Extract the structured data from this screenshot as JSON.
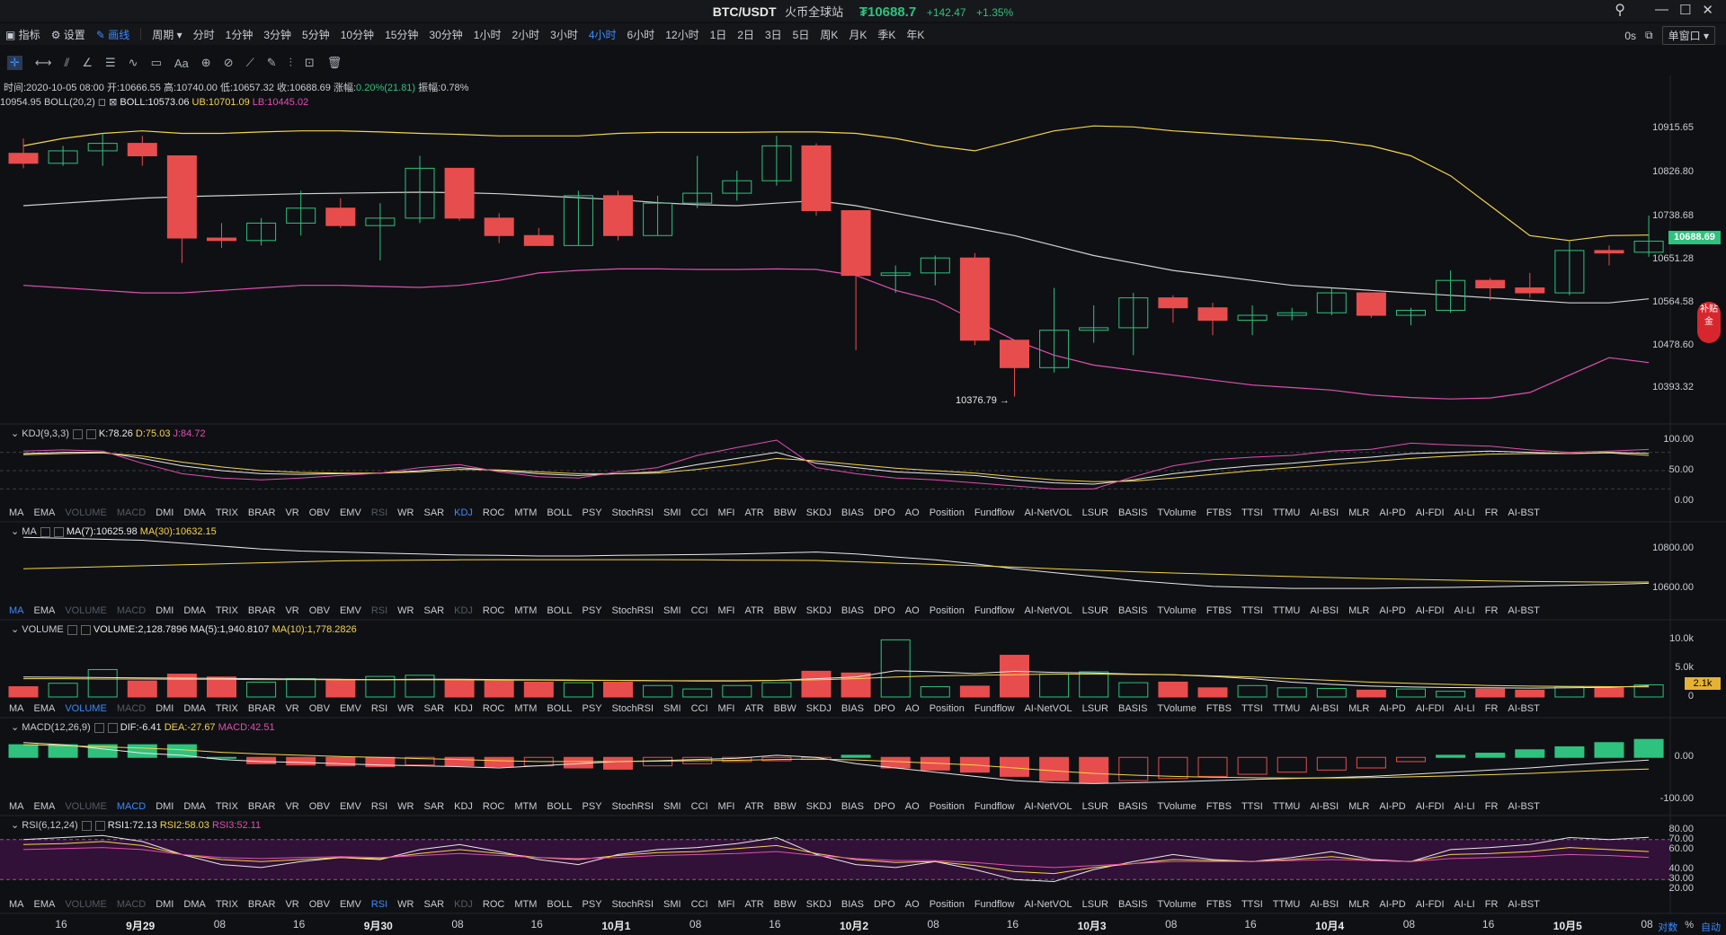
{
  "header": {
    "pair": "BTC/USDT",
    "exchange": "火币全球站",
    "last_price": "₮10688.7",
    "change_abs": "+142.47",
    "change_pct": "+1.35%"
  },
  "period_bar": {
    "items": [
      "指标",
      "设置",
      "画线"
    ],
    "period_label": "周期",
    "periods": [
      "分时",
      "1分钟",
      "3分钟",
      "5分钟",
      "10分钟",
      "15分钟",
      "30分钟",
      "1小时",
      "2小时",
      "3小时",
      "4小时",
      "6小时",
      "12小时",
      "1日",
      "2日",
      "3日",
      "5日",
      "周K",
      "月K",
      "季K",
      "年K"
    ],
    "active_period": "4小时",
    "countdown": "0s",
    "window_select": "单窗口"
  },
  "toolbar_icons": [
    "crosshair-icon",
    "horizontal-line-icon",
    "trend-lines-icon",
    "angle-icon",
    "parallel-lines-icon",
    "wave-icon",
    "rectangle-icon",
    "text-icon",
    "magnet-icon",
    "link-icon",
    "ruler-icon",
    "pencil-icon",
    "bars-icon",
    "lock-icon",
    "trash-icon"
  ],
  "toolbar_text": "Aa",
  "info_line": {
    "time": "时间:2020-10-05 08:00",
    "open": "开:10666.55",
    "high": "高:10740.00",
    "low": "低:10657.32",
    "close": "收:10688.69",
    "change_label": "涨幅:",
    "change_val": "0.20%(21.81)",
    "amp": "振幅:0.78%"
  },
  "boll_line": {
    "prefix": "10954.95",
    "label": "BOLL(20,2)",
    "mid": "BOLL:10573.06",
    "ub": "UB:10701.09",
    "lb": "LB:10445.02"
  },
  "price_axis": [
    "10915.65",
    "10826.80",
    "10738.68",
    "10651.28",
    "10564.58",
    "10478.60",
    "10393.32"
  ],
  "price_badge": "10688.69",
  "low_annotation": "10376.79 →",
  "kdj": {
    "label": "KDJ(9,3,3)",
    "k": "K:78.26",
    "d": "D:75.03",
    "j": "J:84.72",
    "axis": [
      "100.00",
      "50.00",
      "0.00"
    ]
  },
  "ma": {
    "label": "MA",
    "ma7": "MA(7):10625.98",
    "ma30": "MA(30):10632.15",
    "axis": [
      "10800.00",
      "10600.00"
    ]
  },
  "volume": {
    "label": "VOLUME",
    "vol": "VOLUME:2,128.7896",
    "ma5": "MA(5):1,940.8107",
    "ma10": "MA(10):1,778.2826",
    "axis": [
      "10.0k",
      "5.0k",
      "0"
    ],
    "badge": "2.1k"
  },
  "macd": {
    "label": "MACD(12,26,9)",
    "dif": "DIF:-6.41",
    "dea": "DEA:-27.67",
    "macd": "MACD:42.51",
    "axis": [
      "0.00",
      "-100.00"
    ]
  },
  "rsi": {
    "label": "RSI(6,12,24)",
    "rsi1": "RSI1:72.13",
    "rsi2": "RSI2:58.03",
    "rsi3": "RSI3:52.11",
    "axis": [
      "80.00",
      "70.00",
      "60.00",
      "40.00",
      "30.00",
      "20.00"
    ]
  },
  "indicator_list": [
    "MA",
    "EMA",
    "VOLUME",
    "MACD",
    "DMI",
    "DMA",
    "TRIX",
    "BRAR",
    "VR",
    "OBV",
    "EMV",
    "RSI",
    "WR",
    "SAR",
    "KDJ",
    "ROC",
    "MTM",
    "BOLL",
    "PSY",
    "StochRSI",
    "SMI",
    "CCI",
    "MFI",
    "ATR",
    "BBW",
    "SKDJ",
    "BIAS",
    "DPO",
    "AO",
    "Position",
    "Fundflow",
    "AI-NetVOL",
    "LSUR",
    "BASIS",
    "TVolume",
    "FTBS",
    "TTSI",
    "TTMU",
    "AI-BSI",
    "MLR",
    "AI-PD",
    "AI-FDI",
    "AI-LI",
    "FR",
    "AI-BST"
  ],
  "x_axis": [
    {
      "t": "16",
      "b": false
    },
    {
      "t": "9月29",
      "b": true
    },
    {
      "t": "08",
      "b": false
    },
    {
      "t": "16",
      "b": false
    },
    {
      "t": "9月30",
      "b": true
    },
    {
      "t": "08",
      "b": false
    },
    {
      "t": "16",
      "b": false
    },
    {
      "t": "10月1",
      "b": true
    },
    {
      "t": "08",
      "b": false
    },
    {
      "t": "16",
      "b": false
    },
    {
      "t": "10月2",
      "b": true
    },
    {
      "t": "08",
      "b": false
    },
    {
      "t": "16",
      "b": false
    },
    {
      "t": "10月3",
      "b": true
    },
    {
      "t": "08",
      "b": false
    },
    {
      "t": "16",
      "b": false
    },
    {
      "t": "10月4",
      "b": true
    },
    {
      "t": "08",
      "b": false
    },
    {
      "t": "16",
      "b": false
    },
    {
      "t": "10月5",
      "b": true
    },
    {
      "t": "08",
      "b": false
    }
  ],
  "bottom_links": [
    "对数",
    "%",
    "自动"
  ],
  "side_badge": "补贴金",
  "colors": {
    "up": "#2ec27e",
    "down": "#e84d4d",
    "ub": "#f5d547",
    "lb": "#e04fb0",
    "mid": "#d0d0d0",
    "accent": "#3b8bff"
  },
  "chart_data": {
    "type": "candlestick",
    "interval": "4小时",
    "ylim": [
      10340,
      10960
    ],
    "candles": [
      {
        "o": 10865,
        "h": 10895,
        "l": 10835,
        "c": 10845
      },
      {
        "o": 10845,
        "h": 10880,
        "l": 10840,
        "c": 10870
      },
      {
        "o": 10870,
        "h": 10905,
        "l": 10840,
        "c": 10885
      },
      {
        "o": 10885,
        "h": 10900,
        "l": 10840,
        "c": 10860
      },
      {
        "o": 10860,
        "h": 10860,
        "l": 10645,
        "c": 10695
      },
      {
        "o": 10695,
        "h": 10725,
        "l": 10675,
        "c": 10690
      },
      {
        "o": 10690,
        "h": 10735,
        "l": 10680,
        "c": 10725
      },
      {
        "o": 10725,
        "h": 10790,
        "l": 10700,
        "c": 10755
      },
      {
        "o": 10755,
        "h": 10775,
        "l": 10715,
        "c": 10720
      },
      {
        "o": 10720,
        "h": 10765,
        "l": 10650,
        "c": 10735
      },
      {
        "o": 10735,
        "h": 10860,
        "l": 10725,
        "c": 10835
      },
      {
        "o": 10835,
        "h": 10835,
        "l": 10730,
        "c": 10735
      },
      {
        "o": 10735,
        "h": 10745,
        "l": 10685,
        "c": 10700
      },
      {
        "o": 10700,
        "h": 10715,
        "l": 10680,
        "c": 10680
      },
      {
        "o": 10680,
        "h": 10790,
        "l": 10680,
        "c": 10780
      },
      {
        "o": 10780,
        "h": 10790,
        "l": 10690,
        "c": 10700
      },
      {
        "o": 10700,
        "h": 10780,
        "l": 10700,
        "c": 10765
      },
      {
        "o": 10765,
        "h": 10860,
        "l": 10755,
        "c": 10785
      },
      {
        "o": 10785,
        "h": 10830,
        "l": 10770,
        "c": 10810
      },
      {
        "o": 10810,
        "h": 10900,
        "l": 10800,
        "c": 10880
      },
      {
        "o": 10880,
        "h": 10885,
        "l": 10740,
        "c": 10750
      },
      {
        "o": 10750,
        "h": 10750,
        "l": 10470,
        "c": 10620
      },
      {
        "o": 10620,
        "h": 10640,
        "l": 10585,
        "c": 10625
      },
      {
        "o": 10625,
        "h": 10660,
        "l": 10600,
        "c": 10655
      },
      {
        "o": 10655,
        "h": 10665,
        "l": 10480,
        "c": 10490
      },
      {
        "o": 10490,
        "h": 10490,
        "l": 10377,
        "c": 10435
      },
      {
        "o": 10435,
        "h": 10595,
        "l": 10425,
        "c": 10510
      },
      {
        "o": 10510,
        "h": 10560,
        "l": 10485,
        "c": 10515
      },
      {
        "o": 10515,
        "h": 10585,
        "l": 10460,
        "c": 10575
      },
      {
        "o": 10575,
        "h": 10580,
        "l": 10525,
        "c": 10555
      },
      {
        "o": 10555,
        "h": 10565,
        "l": 10500,
        "c": 10530
      },
      {
        "o": 10530,
        "h": 10560,
        "l": 10500,
        "c": 10540
      },
      {
        "o": 10540,
        "h": 10555,
        "l": 10530,
        "c": 10545
      },
      {
        "o": 10545,
        "h": 10595,
        "l": 10540,
        "c": 10585
      },
      {
        "o": 10585,
        "h": 10585,
        "l": 10535,
        "c": 10540
      },
      {
        "o": 10540,
        "h": 10555,
        "l": 10520,
        "c": 10550
      },
      {
        "o": 10550,
        "h": 10630,
        "l": 10545,
        "c": 10610
      },
      {
        "o": 10610,
        "h": 10615,
        "l": 10570,
        "c": 10595
      },
      {
        "o": 10595,
        "h": 10625,
        "l": 10575,
        "c": 10585
      },
      {
        "o": 10585,
        "h": 10690,
        "l": 10580,
        "c": 10670
      },
      {
        "o": 10670,
        "h": 10680,
        "l": 10640,
        "c": 10665
      },
      {
        "o": 10666.55,
        "h": 10740,
        "l": 10657.32,
        "c": 10688.69
      }
    ],
    "boll_ub": [
      10880,
      10895,
      10905,
      10910,
      10905,
      10905,
      10908,
      10910,
      10910,
      10908,
      10905,
      10903,
      10900,
      10900,
      10900,
      10905,
      10907,
      10907,
      10907,
      10908,
      10908,
      10905,
      10895,
      10880,
      10870,
      10890,
      10910,
      10920,
      10918,
      10910,
      10905,
      10900,
      10895,
      10890,
      10880,
      10860,
      10820,
      10760,
      10700,
      10690,
      10700,
      10701
    ],
    "boll_mid": [
      10760,
      10765,
      10770,
      10775,
      10778,
      10780,
      10782,
      10784,
      10785,
      10786,
      10787,
      10786,
      10784,
      10780,
      10776,
      10772,
      10766,
      10762,
      10760,
      10765,
      10770,
      10760,
      10745,
      10730,
      10715,
      10700,
      10680,
      10660,
      10645,
      10630,
      10620,
      10610,
      10600,
      10595,
      10590,
      10585,
      10580,
      10575,
      10570,
      10565,
      10565,
      10573
    ],
    "boll_lb": [
      10600,
      10595,
      10590,
      10585,
      10585,
      10590,
      10595,
      10600,
      10600,
      10598,
      10596,
      10600,
      10610,
      10625,
      10630,
      10633,
      10633,
      10632,
      10632,
      10633,
      10632,
      10620,
      10590,
      10570,
      10530,
      10490,
      10460,
      10440,
      10430,
      10420,
      10410,
      10400,
      10395,
      10390,
      10380,
      10375,
      10372,
      10374,
      10385,
      10420,
      10455,
      10445
    ],
    "kdj_k": [
      78,
      80,
      80,
      70,
      58,
      50,
      45,
      44,
      45,
      46,
      50,
      55,
      50,
      45,
      42,
      45,
      48,
      60,
      70,
      80,
      62,
      55,
      48,
      45,
      42,
      35,
      30,
      28,
      35,
      45,
      52,
      58,
      62,
      68,
      72,
      78,
      80,
      82,
      80,
      78,
      80,
      78.26
    ],
    "kdj_d": [
      76,
      78,
      79,
      74,
      64,
      56,
      50,
      47,
      46,
      46,
      48,
      52,
      51,
      48,
      45,
      45,
      46,
      52,
      60,
      70,
      66,
      60,
      54,
      50,
      46,
      40,
      35,
      32,
      33,
      38,
      44,
      50,
      55,
      60,
      65,
      70,
      74,
      77,
      78,
      78,
      79,
      75.03
    ],
    "kdj_j": [
      82,
      84,
      82,
      62,
      45,
      38,
      35,
      38,
      42,
      46,
      55,
      60,
      48,
      40,
      38,
      48,
      55,
      75,
      88,
      100,
      55,
      45,
      38,
      35,
      30,
      25,
      20,
      20,
      40,
      58,
      68,
      72,
      75,
      82,
      85,
      95,
      92,
      90,
      84,
      80,
      82,
      84.72
    ],
    "ma7": [
      10860,
      10855,
      10850,
      10845,
      10830,
      10815,
      10800,
      10790,
      10785,
      10780,
      10775,
      10770,
      10768,
      10765,
      10765,
      10768,
      10770,
      10772,
      10775,
      10780,
      10785,
      10775,
      10760,
      10745,
      10725,
      10700,
      10680,
      10660,
      10640,
      10625,
      10610,
      10605,
      10600,
      10600,
      10600,
      10603,
      10605,
      10608,
      10612,
      10616,
      10620,
      10625.98
    ],
    "ma30": [
      10700,
      10705,
      10710,
      10715,
      10720,
      10725,
      10730,
      10735,
      10740,
      10742,
      10744,
      10745,
      10746,
      10746,
      10746,
      10746,
      10746,
      10745,
      10744,
      10743,
      10742,
      10735,
      10728,
      10722,
      10715,
      10708,
      10700,
      10692,
      10685,
      10678,
      10672,
      10666,
      10660,
      10655,
      10650,
      10646,
      10642,
      10638,
      10635,
      10633,
      10632,
      10632.15
    ],
    "volume": [
      1800,
      2400,
      4800,
      2800,
      4000,
      3500,
      2600,
      3200,
      3000,
      3600,
      3800,
      3000,
      2800,
      2600,
      2500,
      2600,
      2000,
      1400,
      2000,
      2500,
      4500,
      4200,
      10000,
      1800,
      1900,
      7300,
      4000,
      4400,
      2500,
      2600,
      1600,
      2000,
      1600,
      1500,
      1200,
      1400,
      1000,
      1400,
      1200,
      1800,
      1600,
      2128.79
    ],
    "vol_ma5": [
      3500,
      3450,
      3400,
      3350,
      3300,
      3250,
      3200,
      3150,
      3100,
      3050,
      3100,
      3100,
      3050,
      3000,
      2950,
      2900,
      2850,
      2800,
      2800,
      2900,
      3200,
      3500,
      4600,
      4400,
      4100,
      4500,
      4300,
      4200,
      4000,
      3900,
      3600,
      3200,
      2600,
      2200,
      1900,
      1750,
      1650,
      1600,
      1550,
      1600,
      1700,
      1940.81
    ],
    "vol_ma10": [
      3200,
      3200,
      3150,
      3150,
      3100,
      3100,
      3050,
      3050,
      3000,
      3000,
      3000,
      3000,
      2950,
      2950,
      2900,
      2900,
      2850,
      2850,
      2850,
      2900,
      3000,
      3200,
      3500,
      3700,
      3800,
      3900,
      4000,
      4000,
      3950,
      3900,
      3700,
      3500,
      3200,
      2900,
      2600,
      2400,
      2200,
      2000,
      1900,
      1850,
      1800,
      1778.28
    ],
    "macd_hist": [
      30,
      30,
      30,
      30,
      30,
      0,
      -15,
      -18,
      -20,
      -22,
      -18,
      -20,
      -22,
      -20,
      -25,
      -28,
      -20,
      -15,
      -10,
      -8,
      -5,
      5,
      -25,
      -30,
      -35,
      -45,
      -55,
      -60,
      -55,
      -50,
      -45,
      -40,
      -35,
      -30,
      -25,
      -10,
      5,
      10,
      18,
      25,
      35,
      42.51
    ],
    "macd_dif": [
      35,
      30,
      20,
      10,
      5,
      -5,
      -10,
      -12,
      -15,
      -18,
      -20,
      -22,
      -25,
      -20,
      -15,
      -10,
      -8,
      -5,
      -2,
      5,
      0,
      -15,
      -25,
      -35,
      -45,
      -55,
      -60,
      -62,
      -60,
      -58,
      -55,
      -52,
      -50,
      -48,
      -45,
      -40,
      -35,
      -30,
      -25,
      -18,
      -12,
      -6.41
    ],
    "macd_dea": [
      30,
      28,
      25,
      22,
      18,
      12,
      8,
      5,
      2,
      0,
      -3,
      -5,
      -8,
      -10,
      -10,
      -10,
      -9,
      -8,
      -7,
      -5,
      -4,
      -6,
      -10,
      -14,
      -18,
      -25,
      -32,
      -38,
      -42,
      -45,
      -47,
      -48,
      -49,
      -49,
      -48,
      -46,
      -44,
      -41,
      -38,
      -34,
      -30,
      -27.67
    ],
    "rsi1": [
      70,
      72,
      74,
      68,
      55,
      45,
      42,
      48,
      52,
      50,
      60,
      65,
      58,
      50,
      45,
      55,
      60,
      62,
      66,
      72,
      55,
      45,
      42,
      48,
      40,
      30,
      28,
      40,
      48,
      55,
      50,
      48,
      52,
      58,
      50,
      48,
      60,
      62,
      65,
      72,
      70,
      72.13
    ],
    "rsi2": [
      65,
      66,
      68,
      64,
      55,
      50,
      48,
      50,
      52,
      51,
      56,
      60,
      56,
      52,
      50,
      54,
      57,
      58,
      61,
      64,
      56,
      50,
      47,
      48,
      44,
      38,
      36,
      42,
      46,
      50,
      49,
      48,
      50,
      53,
      49,
      48,
      55,
      56,
      58,
      62,
      60,
      58.03
    ],
    "rsi3": [
      60,
      61,
      62,
      60,
      55,
      52,
      51,
      52,
      53,
      52,
      54,
      56,
      54,
      52,
      51,
      52,
      54,
      55,
      56,
      58,
      54,
      51,
      49,
      49,
      47,
      44,
      42,
      44,
      46,
      48,
      48,
      48,
      49,
      50,
      49,
      48,
      51,
      52,
      53,
      55,
      54,
      52.11
    ]
  }
}
